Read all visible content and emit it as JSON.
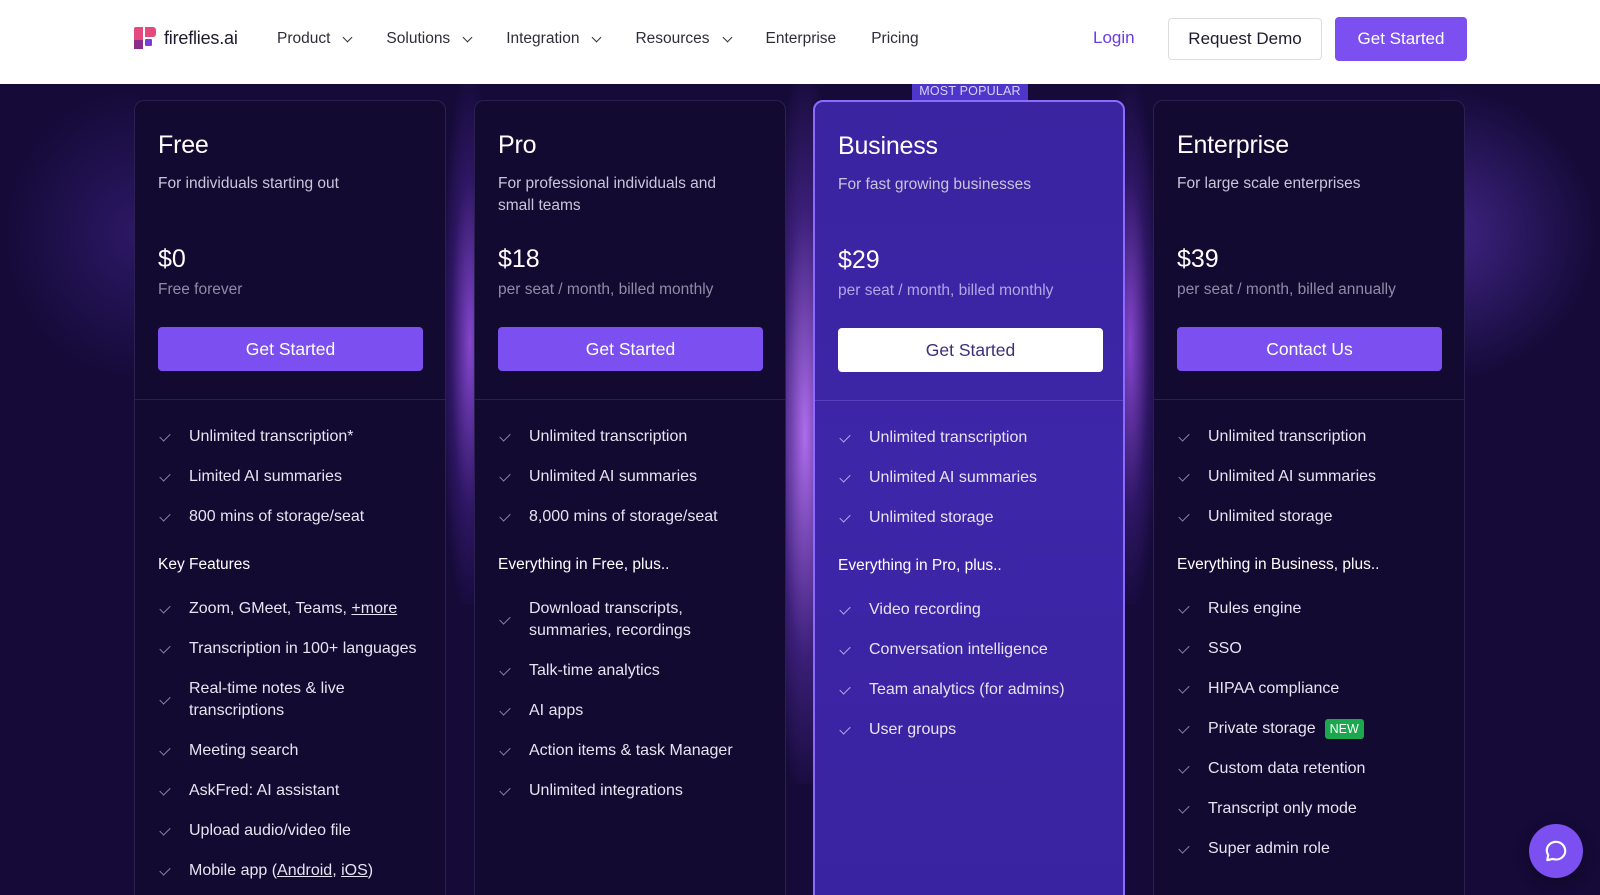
{
  "nav": {
    "brand": "fireflies.ai",
    "menu": [
      {
        "label": "Product",
        "has_dropdown": true
      },
      {
        "label": "Solutions",
        "has_dropdown": true
      },
      {
        "label": "Integration",
        "has_dropdown": true
      },
      {
        "label": "Resources",
        "has_dropdown": true
      },
      {
        "label": "Enterprise",
        "has_dropdown": false
      },
      {
        "label": "Pricing",
        "has_dropdown": false
      }
    ],
    "login": "Login",
    "request_demo": "Request Demo",
    "get_started": "Get Started"
  },
  "most_popular_label": "MOST POPULAR",
  "plans": [
    {
      "name": "Free",
      "subtitle": "For individuals starting out",
      "price": "$0",
      "period": "Free forever",
      "cta": "Get Started",
      "features": [
        "Unlimited transcription*",
        "Limited AI summaries",
        "800 mins of storage/seat"
      ],
      "section_title": "Key Features",
      "extras": {
        "zoom_prefix": "Zoom, GMeet, Teams, ",
        "more_link": "+more",
        "items": [
          "Transcription in 100+ languages",
          "Real-time notes & live transcriptions",
          "Meeting search",
          "AskFred: AI assistant",
          "Upload audio/video file"
        ],
        "mobile_prefix": "Mobile app (",
        "android": "Android",
        "sep": ", ",
        "ios": "iOS",
        "mobile_suffix": ")"
      }
    },
    {
      "name": "Pro",
      "subtitle": "For professional individuals and small teams",
      "price": "$18",
      "period": "per seat / month, billed monthly",
      "cta": "Get Started",
      "features": [
        "Unlimited transcription",
        "Unlimited AI summaries",
        "8,000 mins of storage/seat"
      ],
      "section_title": "Everything in Free, plus..",
      "extras": [
        "Download transcripts, summaries, recordings",
        "Talk-time analytics",
        "AI apps",
        "Action items & task Manager",
        "Unlimited integrations"
      ]
    },
    {
      "name": "Business",
      "subtitle": "For fast growing businesses",
      "price": "$29",
      "period": "per seat / month, billed monthly",
      "cta": "Get Started",
      "features": [
        "Unlimited transcription",
        "Unlimited AI summaries",
        "Unlimited storage"
      ],
      "section_title": "Everything in Pro, plus..",
      "extras": [
        "Video recording",
        "Conversation intelligence",
        "Team analytics (for admins)",
        "User groups"
      ]
    },
    {
      "name": "Enterprise",
      "subtitle": "For large scale enterprises",
      "price": "$39",
      "period": "per seat / month, billed annually",
      "cta": "Contact Us",
      "features": [
        "Unlimited transcription",
        "Unlimited AI summaries",
        "Unlimited storage"
      ],
      "section_title": "Everything in Business, plus..",
      "extras": {
        "items_before": [
          "Rules engine",
          "SSO",
          "HIPAA compliance"
        ],
        "private_storage": "Private storage",
        "new_badge": "NEW",
        "items_after": [
          "Custom data retention",
          "Transcript only mode",
          "Super admin role"
        ]
      }
    }
  ],
  "colors": {
    "accent": "#7b4ff0",
    "background": "#150a38",
    "featured_card": "#3a24a0",
    "new_badge": "#1aa74e"
  }
}
